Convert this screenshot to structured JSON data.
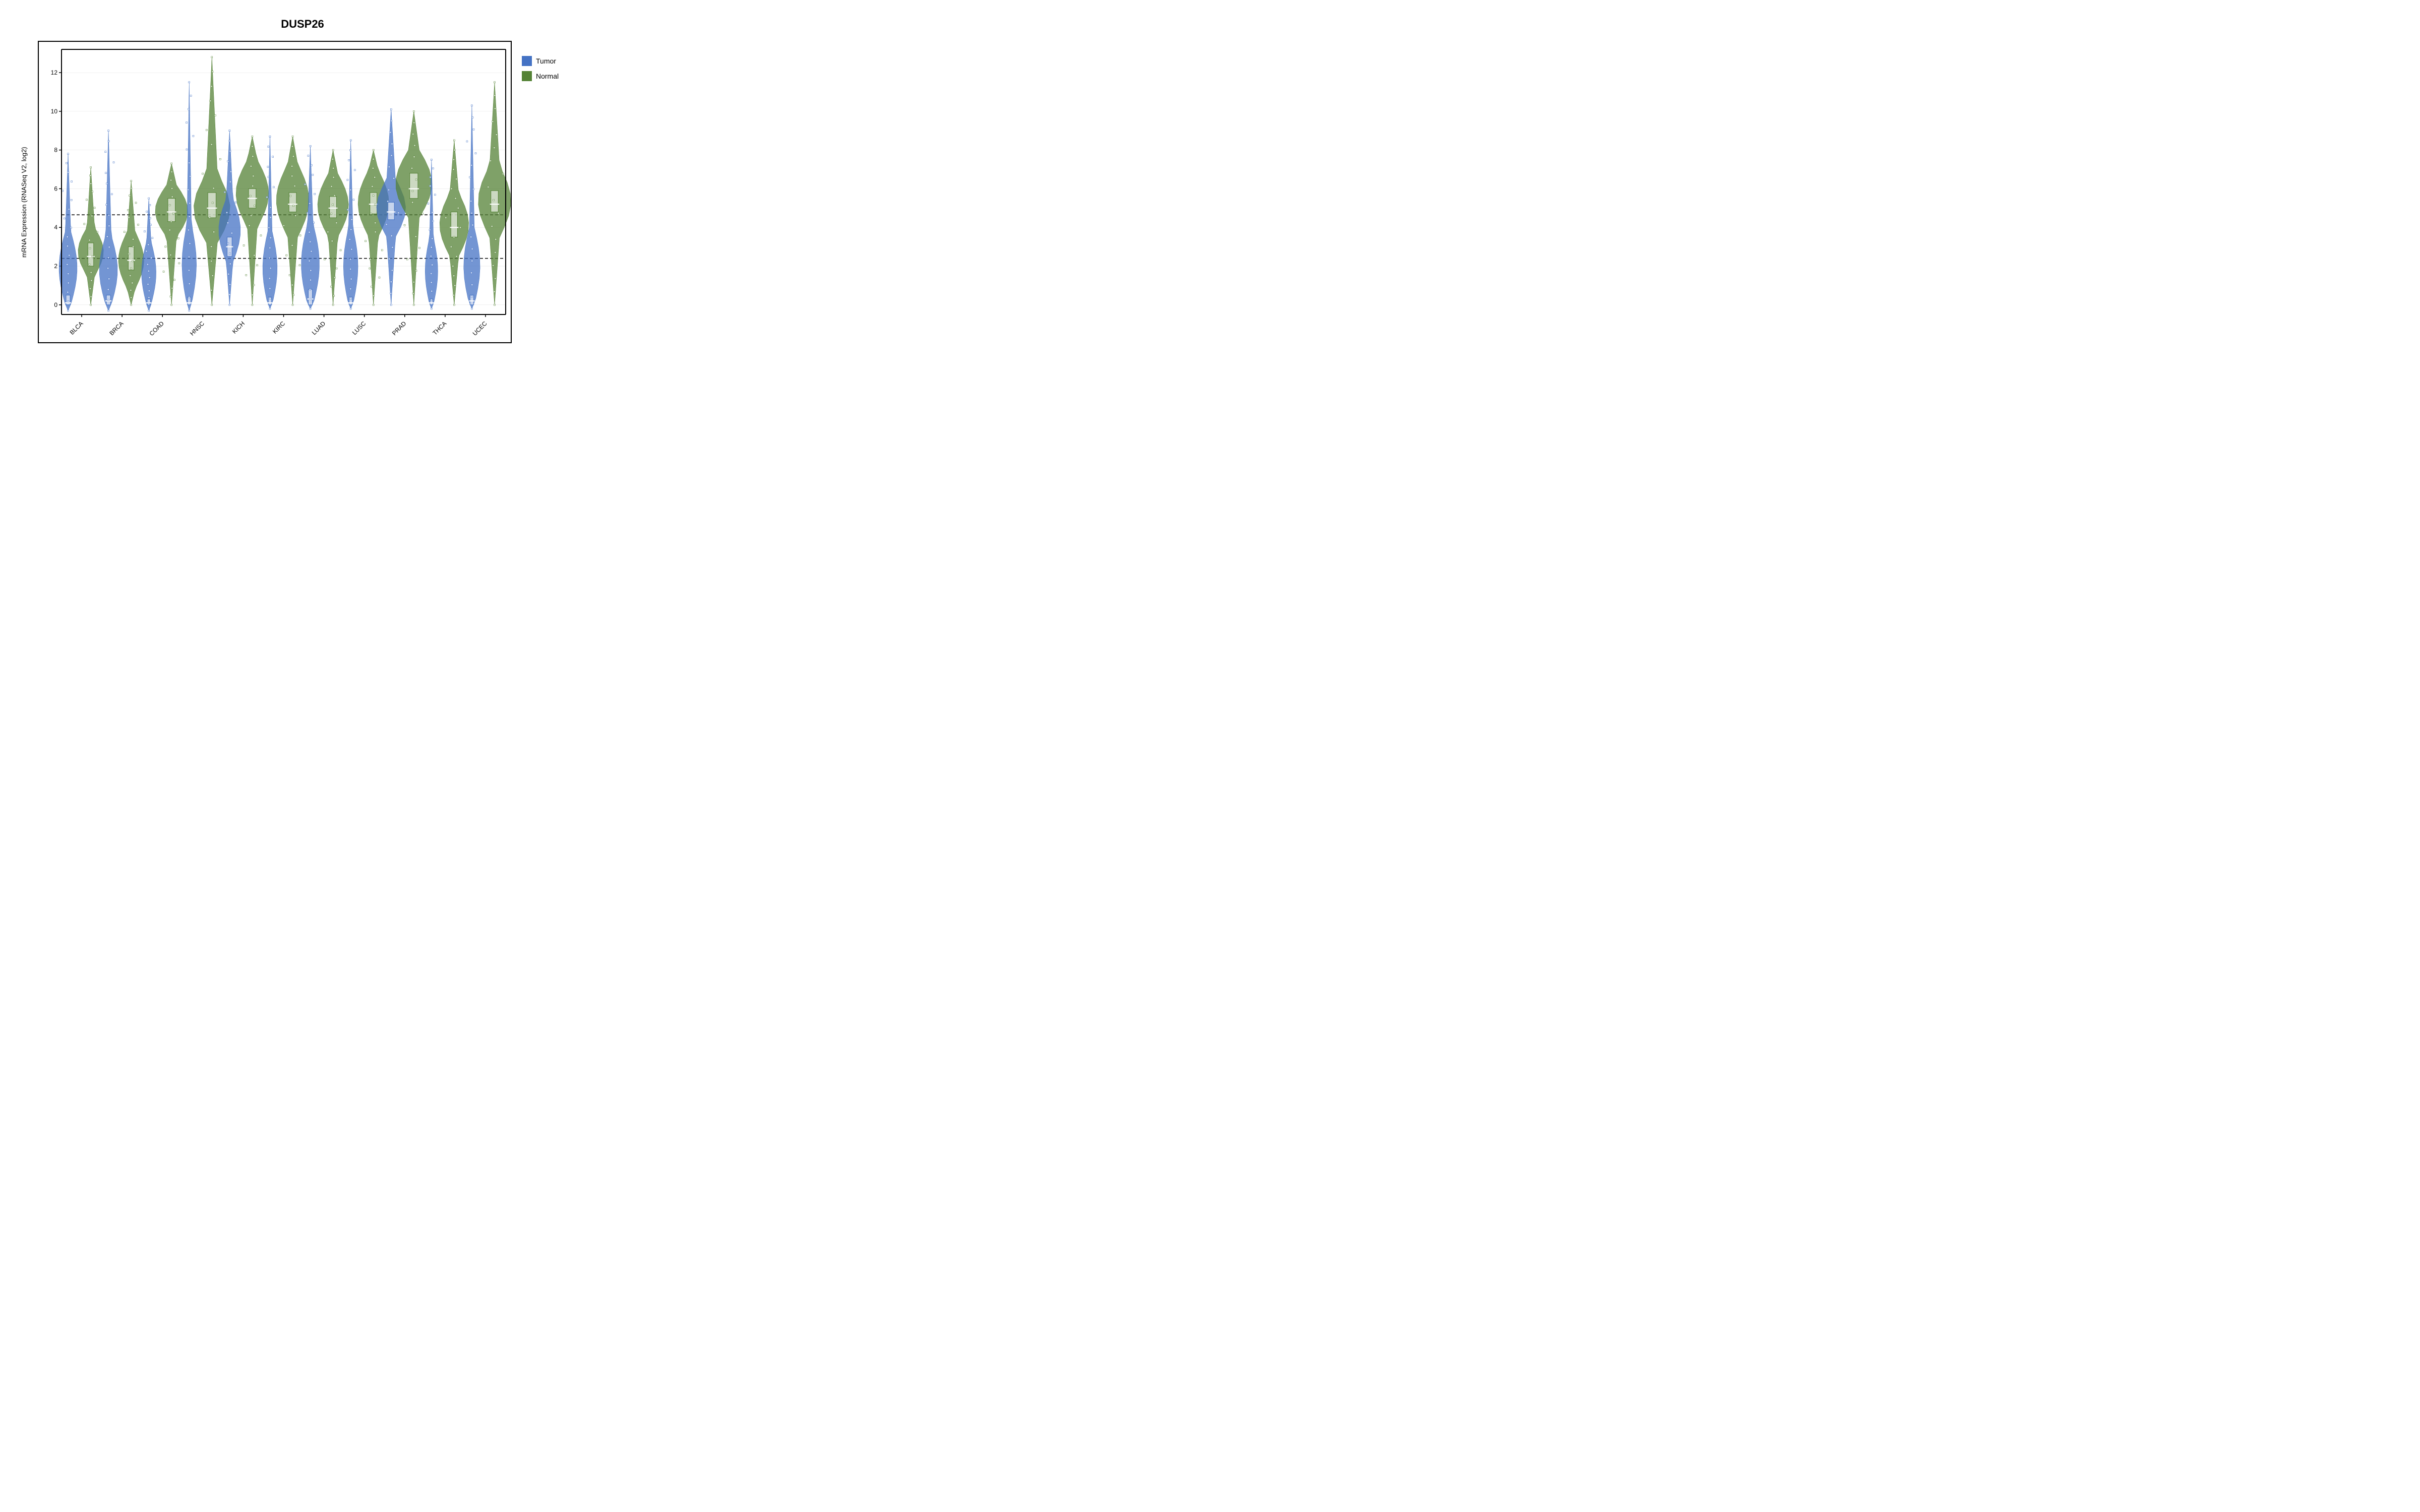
{
  "title": "DUSP26",
  "yaxis_label": "mRNA Expression (RNASeq V2, log2)",
  "legend": {
    "items": [
      {
        "label": "Tumor",
        "color": "#4472C4",
        "name": "tumor"
      },
      {
        "label": "Normal",
        "color": "#548235",
        "name": "normal"
      }
    ]
  },
  "yaxis": {
    "min": -1,
    "max": 13,
    "ticks": [
      0,
      2,
      4,
      6,
      8,
      10,
      12
    ]
  },
  "dotted_lines": [
    2.4,
    4.65
  ],
  "cancer_types": [
    "BLCA",
    "BRCA",
    "COAD",
    "HNSC",
    "KICH",
    "KIRC",
    "LUAD",
    "LUSC",
    "PRAD",
    "THCA",
    "UCEC"
  ],
  "violins": [
    {
      "type": "BLCA",
      "tumor": {
        "median": 0.1,
        "q1": 0.0,
        "q3": 0.5,
        "width": 0.5,
        "top": 7.8,
        "bottom": -0.3,
        "body_top": 3.8,
        "body_bottom": 0.0
      },
      "normal": {
        "median": 2.5,
        "q1": 2.0,
        "q3": 3.2,
        "width": 0.7,
        "top": 7.1,
        "bottom": 0.0,
        "body_top": 4.0,
        "body_bottom": 1.5
      }
    },
    {
      "type": "BRCA",
      "tumor": {
        "median": 0.2,
        "q1": 0.0,
        "q3": 0.5,
        "width": 0.5,
        "top": 9.0,
        "bottom": -0.3,
        "body_top": 3.6,
        "body_bottom": 0.0
      },
      "normal": {
        "median": 2.3,
        "q1": 1.8,
        "q3": 3.0,
        "width": 0.7,
        "top": 6.4,
        "bottom": 0.0,
        "body_top": 3.8,
        "body_bottom": 0.8
      }
    },
    {
      "type": "COAD",
      "tumor": {
        "median": 0.1,
        "q1": 0.0,
        "q3": 0.3,
        "width": 0.4,
        "top": 5.5,
        "bottom": -0.3,
        "body_top": 3.3,
        "body_bottom": 0.0
      },
      "normal": {
        "median": 4.8,
        "q1": 4.3,
        "q3": 5.5,
        "width": 0.9,
        "top": 7.3,
        "bottom": 0.0,
        "body_top": 6.2,
        "body_bottom": 3.5
      }
    },
    {
      "type": "HNSC",
      "tumor": {
        "median": 0.1,
        "q1": 0.0,
        "q3": 0.4,
        "width": 0.4,
        "top": 11.5,
        "bottom": -0.3,
        "body_top": 4.2,
        "body_bottom": 0.0
      },
      "normal": {
        "median": 5.0,
        "q1": 4.5,
        "q3": 5.8,
        "width": 1.0,
        "top": 12.8,
        "bottom": 0.0,
        "body_top": 6.8,
        "body_bottom": 3.2
      }
    },
    {
      "type": "KICH",
      "tumor": {
        "median": 3.0,
        "q1": 2.5,
        "q3": 3.5,
        "width": 0.6,
        "top": 9.0,
        "bottom": 0.0,
        "body_top": 5.5,
        "body_bottom": 2.2
      },
      "normal": {
        "median": 5.5,
        "q1": 5.0,
        "q3": 6.0,
        "width": 0.9,
        "top": 8.7,
        "bottom": 0.0,
        "body_top": 7.5,
        "body_bottom": 4.0
      }
    },
    {
      "type": "KIRC",
      "tumor": {
        "median": 0.1,
        "q1": 0.0,
        "q3": 0.4,
        "width": 0.4,
        "top": 8.7,
        "bottom": -0.2,
        "body_top": 3.8,
        "body_bottom": 0.0
      },
      "normal": {
        "median": 5.2,
        "q1": 4.8,
        "q3": 5.8,
        "width": 0.9,
        "top": 8.7,
        "bottom": 0.0,
        "body_top": 7.3,
        "body_bottom": 3.5
      }
    },
    {
      "type": "LUAD",
      "tumor": {
        "median": 0.3,
        "q1": 0.0,
        "q3": 0.8,
        "width": 0.5,
        "top": 8.2,
        "bottom": -0.2,
        "body_top": 4.2,
        "body_bottom": 0.0
      },
      "normal": {
        "median": 5.0,
        "q1": 4.5,
        "q3": 5.6,
        "width": 0.85,
        "top": 8.0,
        "bottom": 0.0,
        "body_top": 6.8,
        "body_bottom": 3.5
      }
    },
    {
      "type": "LUSC",
      "tumor": {
        "median": 0.1,
        "q1": 0.0,
        "q3": 0.4,
        "width": 0.4,
        "top": 8.5,
        "bottom": -0.2,
        "body_top": 4.0,
        "body_bottom": 0.0
      },
      "normal": {
        "median": 5.2,
        "q1": 4.7,
        "q3": 5.8,
        "width": 0.85,
        "top": 8.0,
        "bottom": 0.0,
        "body_top": 7.0,
        "body_bottom": 3.5
      }
    },
    {
      "type": "PRAD",
      "tumor": {
        "median": 4.8,
        "q1": 4.4,
        "q3": 5.3,
        "width": 0.8,
        "top": 10.1,
        "bottom": 0.0,
        "body_top": 6.5,
        "body_bottom": 3.5
      },
      "normal": {
        "median": 6.0,
        "q1": 5.5,
        "q3": 6.8,
        "width": 1.0,
        "top": 10.0,
        "bottom": 0.0,
        "body_top": 8.0,
        "body_bottom": 4.5
      }
    },
    {
      "type": "THCA",
      "tumor": {
        "median": 0.1,
        "q1": 0.0,
        "q3": 0.3,
        "width": 0.35,
        "top": 7.5,
        "bottom": -0.2,
        "body_top": 3.5,
        "body_bottom": 0.0
      },
      "normal": {
        "median": 4.0,
        "q1": 3.5,
        "q3": 4.8,
        "width": 0.8,
        "top": 8.5,
        "bottom": 0.0,
        "body_top": 5.8,
        "body_bottom": 2.5
      }
    },
    {
      "type": "UCEC",
      "tumor": {
        "median": 0.2,
        "q1": 0.0,
        "q3": 0.5,
        "width": 0.45,
        "top": 10.3,
        "bottom": -0.2,
        "body_top": 4.0,
        "body_bottom": 0.0
      },
      "normal": {
        "median": 5.2,
        "q1": 4.8,
        "q3": 5.9,
        "width": 0.9,
        "top": 11.5,
        "bottom": 0.0,
        "body_top": 7.2,
        "body_bottom": 3.5
      }
    }
  ]
}
